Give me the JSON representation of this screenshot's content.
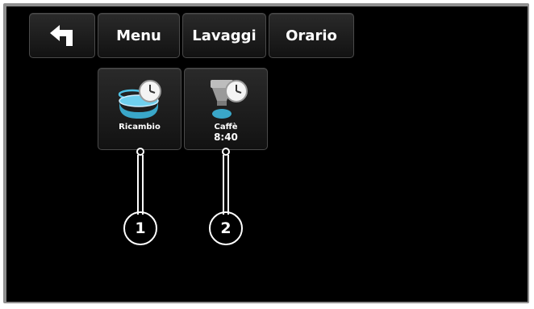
{
  "toolbar": {
    "back_icon": "back-arrow-icon",
    "menu_label": "Menu",
    "lavaggi_label": "Lavaggi",
    "orario_label": "Orario"
  },
  "tiles": [
    {
      "icon": "water-tank-clock-icon",
      "label": "Ricambio",
      "time": ""
    },
    {
      "icon": "coffee-machine-clock-icon",
      "label": "Caffè",
      "time": "8:40"
    }
  ],
  "callouts": [
    "1",
    "2"
  ],
  "colors": {
    "screen": "#000000",
    "frame": "#8f8f8f",
    "accent": "#3aa7c9"
  }
}
